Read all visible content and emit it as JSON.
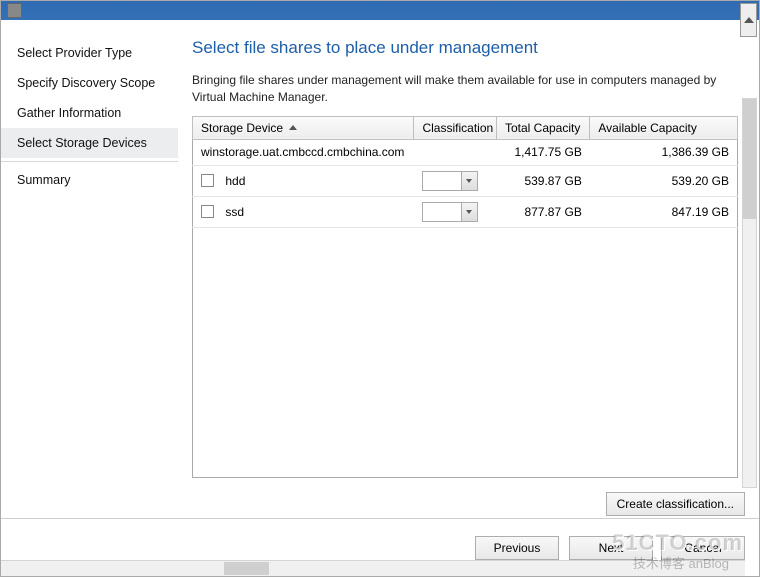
{
  "sidebar": {
    "items": [
      {
        "label": "Select Provider Type"
      },
      {
        "label": "Specify Discovery Scope"
      },
      {
        "label": "Gather Information"
      },
      {
        "label": "Select Storage Devices"
      },
      {
        "label": "Summary"
      }
    ],
    "selected_index": 3
  },
  "main": {
    "title": "Select file shares to place under management",
    "description": "Bringing file shares under management will make them available for use in computers managed by Virtual Machine Manager."
  },
  "grid": {
    "headers": {
      "device": "Storage Device",
      "classification": "Classification",
      "total": "Total Capacity",
      "available": "Available Capacity"
    },
    "rows": [
      {
        "type": "group",
        "device": "winstorage.uat.cmbccd.cmbchina.com",
        "total": "1,417.75 GB",
        "available": "1,386.39 GB"
      },
      {
        "type": "share",
        "device": "hdd",
        "total": "539.87 GB",
        "available": "539.20 GB"
      },
      {
        "type": "share",
        "device": "ssd",
        "total": "877.87 GB",
        "available": "847.19 GB"
      }
    ]
  },
  "buttons": {
    "create_classification": "Create classification...",
    "previous": "Previous",
    "next": "Next",
    "cancel": "Cancel"
  },
  "watermark": {
    "line1": "51CTO.com",
    "line2": "技术博客 anBlog"
  }
}
